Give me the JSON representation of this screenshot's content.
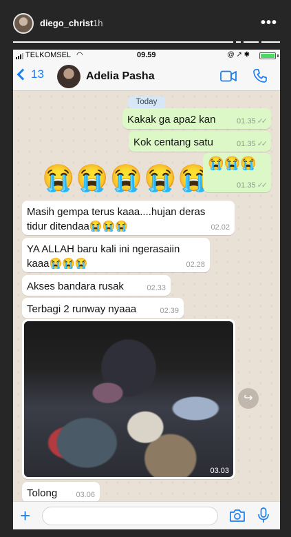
{
  "story": {
    "username": "diego_christ",
    "time_ago": "1h",
    "more_icon": "more-dots-icon"
  },
  "status_bar": {
    "carrier": "TELKOMSEL",
    "time": "09.59",
    "icons": "@ ↗ ✱"
  },
  "nav": {
    "back_count": "13",
    "contact_name": "Adelia Pasha",
    "accent": "#1a7ef2"
  },
  "chat": {
    "date_label": "Today",
    "messages": [
      {
        "dir": "out",
        "text": "Kakak ga apa2 kan",
        "time": "01.35"
      },
      {
        "dir": "out",
        "text": "Kok centang satu",
        "time": "01.35"
      },
      {
        "dir": "out",
        "text": "😭😭😭",
        "time": "01.35"
      },
      {
        "dir": "in",
        "text_line1": "Masih gempa terus kaaa....hujan deras",
        "text_line2": "tidur ditendaa😭😭😭",
        "time": "02.02"
      },
      {
        "dir": "in",
        "text_line1": "YA ALLAH baru kali ini ngerasaiin",
        "text_line2": "kaaa😭😭😭",
        "time": "02.28"
      },
      {
        "dir": "in",
        "text": "Akses bandara rusak",
        "time": "02.33"
      },
      {
        "dir": "in",
        "text": "Terbagi 2 runway nyaaa",
        "time": "02.39"
      },
      {
        "dir": "in",
        "type": "photo",
        "time": "03.03"
      },
      {
        "dir": "in",
        "text": "Tolong",
        "time": "03.06"
      }
    ],
    "big_emoji": "😭😭😭😭😭",
    "ticks": "✓✓",
    "forward_icon": "↪"
  },
  "input": {
    "placeholder": ""
  },
  "colors": {
    "outgoing_bubble": "#dcf8c6",
    "incoming_bubble": "#ffffff",
    "chat_bg": "#e9e1d6"
  }
}
